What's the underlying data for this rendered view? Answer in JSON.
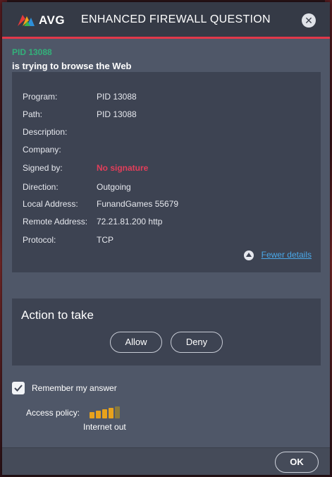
{
  "window": {
    "brand": "AVG",
    "title": "ENHANCED FIREWALL QUESTION",
    "close_glyph": "✕",
    "accent_color": "#e0384a"
  },
  "alert": {
    "pid": "PID 13088",
    "message": "is trying to browse the Web"
  },
  "details": {
    "rows": [
      {
        "label": "Program:",
        "value": "PID 13088"
      },
      {
        "label": "Path:",
        "value": "PID 13088"
      },
      {
        "label": "Description:",
        "value": ""
      },
      {
        "label": "Company:",
        "value": ""
      },
      {
        "label": "Signed by:",
        "value": "No signature",
        "warning": true
      },
      {
        "label": "Direction:",
        "value": "Outgoing"
      },
      {
        "label": "Local Address:",
        "value": "FunandGames 55679"
      },
      {
        "label": "Remote Address:",
        "value": "72.21.81.200 http"
      },
      {
        "label": "Protocol:",
        "value": "TCP"
      }
    ],
    "toggle_label": "Fewer details",
    "toggle_icon": "chevron-up-circle-icon"
  },
  "action": {
    "title": "Action to take",
    "allow_label": "Allow",
    "deny_label": "Deny"
  },
  "remember": {
    "label": "Remember my answer",
    "checked": true
  },
  "policy": {
    "label": "Access policy:",
    "level_label": "Internet out",
    "level": 4,
    "max_level": 5,
    "active_color": "#e8a21c",
    "inactive_color": "#8a7a3c"
  },
  "footer": {
    "ok_label": "OK"
  }
}
